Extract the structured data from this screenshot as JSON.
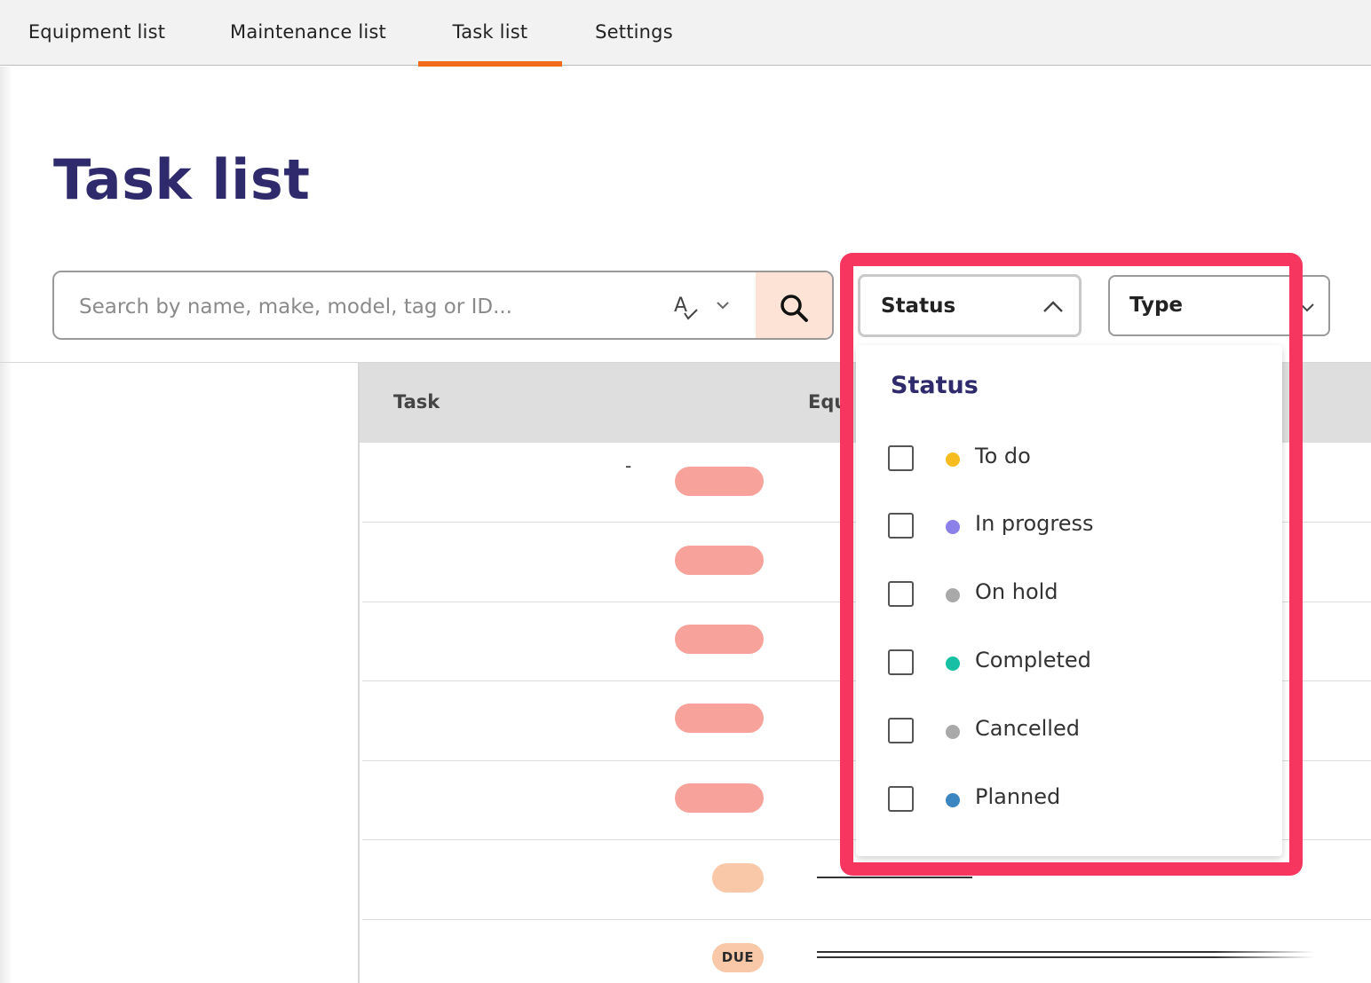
{
  "nav": {
    "tabs": [
      {
        "label": "Equipment list"
      },
      {
        "label": "Maintenance list"
      },
      {
        "label": "Task list",
        "active": true
      },
      {
        "label": "Settings"
      }
    ],
    "accent_color": "#ef6b1a"
  },
  "page": {
    "title": "Task list"
  },
  "search": {
    "placeholder": "Search by name, make, model, tag or ID...",
    "value": ""
  },
  "filters": {
    "status": {
      "label": "Status",
      "expanded": true
    },
    "type": {
      "label": "Type",
      "expanded": false
    }
  },
  "status_panel": {
    "title": "Status",
    "options": [
      {
        "label": "To do",
        "checked": false,
        "color": "#f5bd1f"
      },
      {
        "label": "In progress",
        "checked": false,
        "color": "#8b7fe8"
      },
      {
        "label": "On hold",
        "checked": false,
        "color": "#a9a9a9"
      },
      {
        "label": "Completed",
        "checked": false,
        "color": "#17bfa5"
      },
      {
        "label": "Cancelled",
        "checked": false,
        "color": "#a9a9a9"
      },
      {
        "label": "Planned",
        "checked": false,
        "color": "#3b86c0"
      }
    ]
  },
  "table": {
    "columns": {
      "task": "Task",
      "equipment": "Equ"
    },
    "rows": [
      {
        "task_text": "-",
        "badge": ""
      },
      {
        "badge": ""
      },
      {
        "badge": ""
      },
      {
        "badge": ""
      },
      {
        "badge": ""
      },
      {
        "badge": ""
      },
      {
        "badge": "DUE"
      }
    ]
  },
  "highlight_color": "#f7365f"
}
